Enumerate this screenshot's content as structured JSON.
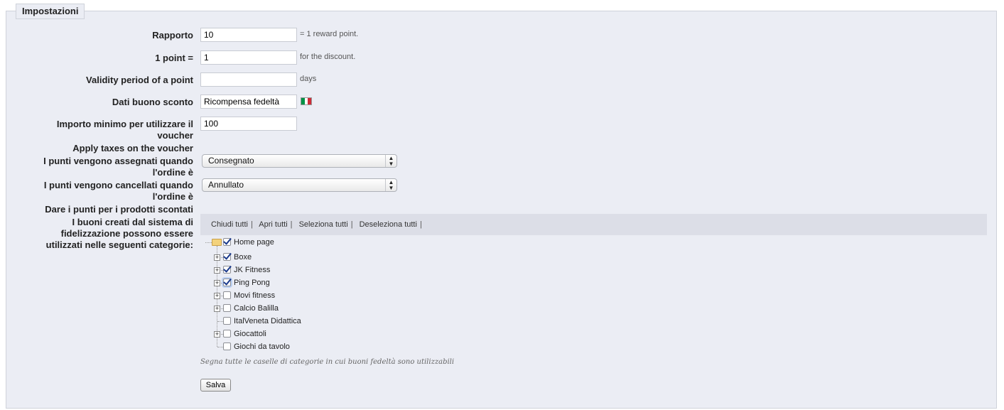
{
  "section": {
    "legend": "Impostazioni"
  },
  "form": {
    "ratio": {
      "label": "Rapporto",
      "value": "10",
      "hint": "= 1 reward point."
    },
    "point_value": {
      "label": "1 point =",
      "value": "1",
      "hint": "for the discount."
    },
    "validity": {
      "label": "Validity period of a point",
      "value": "",
      "hint": "days"
    },
    "voucher_name": {
      "label": "Dati buono sconto",
      "value": "Ricompensa fedeltà",
      "flag_colors": [
        "#009246",
        "#ffffff",
        "#ce2b37"
      ]
    },
    "min_amount": {
      "label": "Importo minimo per utilizzare il voucher",
      "value": "100"
    },
    "apply_taxes": {
      "label": "Apply taxes on the voucher"
    },
    "points_assigned": {
      "label": "I punti vengono assegnati quando l'ordine è",
      "selected": "Consegnato"
    },
    "points_cancelled": {
      "label": "I punti vengono cancellati quando l'ordine è",
      "selected": "Annullato"
    },
    "discounted_products": {
      "label": "Dare i punti per i prodotti scontati"
    },
    "categories": {
      "label": "I buoni creati dal sistema di fidelizzazione possono essere utilizzati nelle seguenti categorie:"
    }
  },
  "tree": {
    "toolbar": [
      "Chiudi tutti",
      "Apri tutti",
      "Seleziona tutti",
      "Deseleziona tutti"
    ],
    "root": {
      "label": "Home page",
      "checked": true,
      "icon": "folder-open-icon"
    },
    "items": [
      {
        "label": "Boxe",
        "checked": true,
        "expandable": true
      },
      {
        "label": "JK Fitness",
        "checked": true,
        "expandable": true
      },
      {
        "label": "Ping Pong",
        "checked": true,
        "expandable": true
      },
      {
        "label": "Movi fitness",
        "checked": false,
        "expandable": true
      },
      {
        "label": "Calcio Balilla",
        "checked": false,
        "expandable": true
      },
      {
        "label": "ItalVeneta Didattica",
        "checked": false,
        "expandable": false
      },
      {
        "label": "Giocattoli",
        "checked": false,
        "expandable": true
      },
      {
        "label": "Giochi da tavolo",
        "checked": false,
        "expandable": false
      }
    ],
    "note": "Segna tutte le caselle di categorie in cui buoni fedeltà sono utilizzabili"
  },
  "actions": {
    "save_label": "Salva"
  }
}
